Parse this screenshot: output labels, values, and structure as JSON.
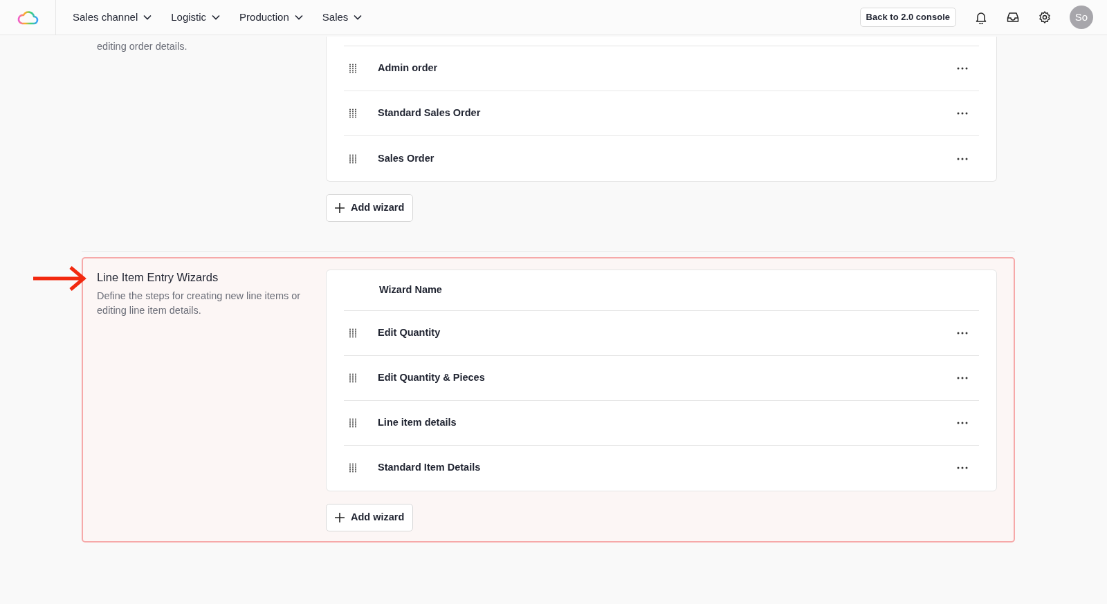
{
  "navbar": {
    "menus": [
      {
        "label": "Sales channel"
      },
      {
        "label": "Logistic"
      },
      {
        "label": "Production"
      },
      {
        "label": "Sales"
      }
    ],
    "console_button": "Back to 2.0 console",
    "avatar": "So"
  },
  "sections": [
    {
      "description": "editing order details.",
      "highlighted": false,
      "wizards": [
        {
          "name": "Admin order"
        },
        {
          "name": "Standard Sales Order"
        },
        {
          "name": "Sales Order"
        }
      ],
      "add_button": "Add wizard"
    },
    {
      "title": "Line Item Entry Wizards",
      "description": "Define the steps for creating new line items or editing line item details.",
      "column_header": "Wizard Name",
      "highlighted": true,
      "wizards": [
        {
          "name": "Edit Quantity"
        },
        {
          "name": "Edit Quantity & Pieces"
        },
        {
          "name": "Line item details"
        },
        {
          "name": "Standard Item Details"
        }
      ],
      "add_button": "Add wizard"
    }
  ]
}
